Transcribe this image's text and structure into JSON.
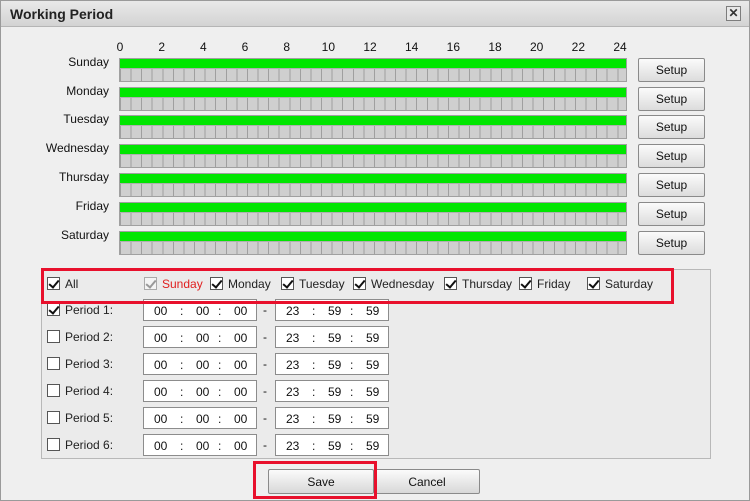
{
  "dialog": {
    "title": "Working Period",
    "close_icon": "close-icon"
  },
  "hours": [
    "0",
    "2",
    "4",
    "6",
    "8",
    "10",
    "12",
    "14",
    "16",
    "18",
    "20",
    "22",
    "24"
  ],
  "days": [
    {
      "label": "Sunday",
      "setup_label": "Setup",
      "active_fraction": 1.0
    },
    {
      "label": "Monday",
      "setup_label": "Setup",
      "active_fraction": 1.0
    },
    {
      "label": "Tuesday",
      "setup_label": "Setup",
      "active_fraction": 1.0
    },
    {
      "label": "Wednesday",
      "setup_label": "Setup",
      "active_fraction": 1.0
    },
    {
      "label": "Thursday",
      "setup_label": "Setup",
      "active_fraction": 1.0
    },
    {
      "label": "Friday",
      "setup_label": "Setup",
      "active_fraction": 1.0
    },
    {
      "label": "Saturday",
      "setup_label": "Setup",
      "active_fraction": 1.0
    }
  ],
  "day_select": {
    "all": {
      "label": "All",
      "checked": true
    },
    "days": [
      {
        "label": "Sunday",
        "checked": true,
        "disabled": true,
        "color": "#e02020"
      },
      {
        "label": "Monday",
        "checked": true
      },
      {
        "label": "Tuesday",
        "checked": true
      },
      {
        "label": "Wednesday",
        "checked": true
      },
      {
        "label": "Thursday",
        "checked": true
      },
      {
        "label": "Friday",
        "checked": true
      },
      {
        "label": "Saturday",
        "checked": true
      }
    ]
  },
  "periods": [
    {
      "label": "Period 1:",
      "checked": true,
      "start": [
        "00",
        "00",
        "00"
      ],
      "end": [
        "23",
        "59",
        "59"
      ]
    },
    {
      "label": "Period 2:",
      "checked": false,
      "start": [
        "00",
        "00",
        "00"
      ],
      "end": [
        "23",
        "59",
        "59"
      ]
    },
    {
      "label": "Period 3:",
      "checked": false,
      "start": [
        "00",
        "00",
        "00"
      ],
      "end": [
        "23",
        "59",
        "59"
      ]
    },
    {
      "label": "Period 4:",
      "checked": false,
      "start": [
        "00",
        "00",
        "00"
      ],
      "end": [
        "23",
        "59",
        "59"
      ]
    },
    {
      "label": "Period 5:",
      "checked": false,
      "start": [
        "00",
        "00",
        "00"
      ],
      "end": [
        "23",
        "59",
        "59"
      ]
    },
    {
      "label": "Period 6:",
      "checked": false,
      "start": [
        "00",
        "00",
        "00"
      ],
      "end": [
        "23",
        "59",
        "59"
      ]
    }
  ],
  "separators": {
    "time": ":",
    "range": "-"
  },
  "buttons": {
    "save": "Save",
    "cancel": "Cancel"
  },
  "colors": {
    "active_bar": "#00e600",
    "highlight": "#e8102c",
    "sunday_label": "#e02020"
  }
}
